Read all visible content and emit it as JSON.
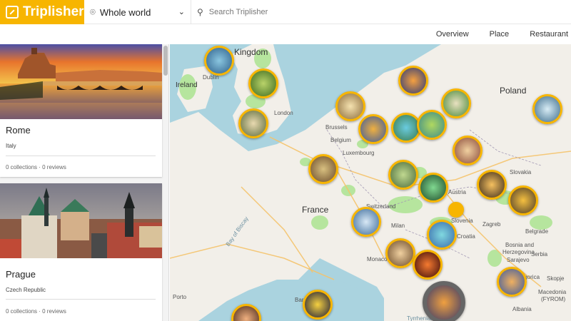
{
  "header": {
    "brand": "Triplisher",
    "region": {
      "value": "Whole world"
    },
    "search": {
      "placeholder": "Search Triplisher"
    }
  },
  "tabs": [
    {
      "label": "Overview"
    },
    {
      "label": "Place"
    },
    {
      "label": "Restaurant"
    }
  ],
  "places": [
    {
      "name": "Rome",
      "country": "Italy",
      "meta": "0 collections · 0 reviews"
    },
    {
      "name": "Prague",
      "country": "Czech Republic",
      "meta": "0 collections · 0 reviews"
    }
  ],
  "map": {
    "countries": [
      "Kingdom",
      "Ireland",
      "Poland",
      "France",
      "Slovakia",
      "Austria",
      "Croatia",
      "Bosnia and",
      "Herzegovina",
      "Serbia",
      "Macedonia",
      "(FYROM)",
      "Albania",
      "Switzerland",
      "Belgium",
      "Slovenia"
    ],
    "cities": [
      "Dublin",
      "London",
      "Brussels",
      "Luxembourg",
      "Milan",
      "Monaco",
      "Zagreb",
      "Belgrade",
      "Sarajevo",
      "Podgorica",
      "Skopje",
      "Barcelona",
      "Porto"
    ],
    "water": [
      "Bay of Biscay",
      "Tyrrhenian Sea"
    ]
  },
  "colors": {
    "brand": "#f7b500",
    "map_water": "#aad3df",
    "map_land": "#f2efe9",
    "map_green": "#b6e59e"
  }
}
